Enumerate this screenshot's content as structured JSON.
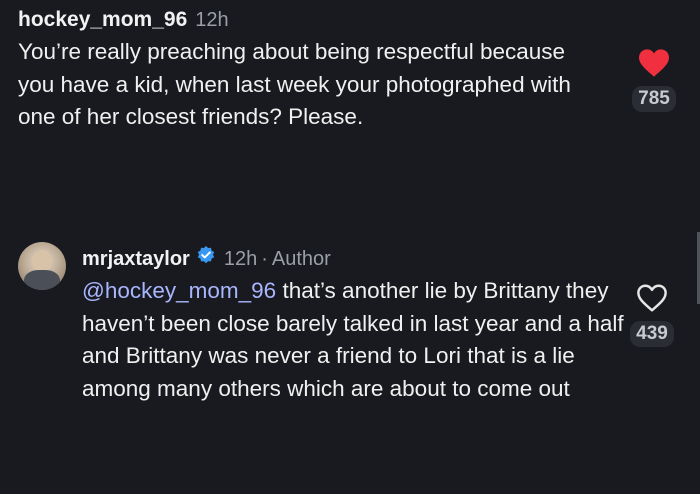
{
  "comments": [
    {
      "username": "hockey_mom_96",
      "time": "12h",
      "text": "You’re  really preaching about being respectful because you have a kid, when last week your photographed with one of her closest friends? Please.",
      "likes": "785",
      "liked": true
    },
    {
      "username": "mrjaxtaylor",
      "time": "12h",
      "separator": "·",
      "badge": "Author",
      "mention": "@hockey_mom_96",
      "text": " that’s another lie by Brittany they haven’t been close barely talked in last year and a half and Brittany was never a friend to Lori that is a lie among many others which are about to come out",
      "likes": "439",
      "liked": false,
      "verified": true
    }
  ],
  "colors": {
    "background": "#181a1f",
    "heart_filled": "#f0303f",
    "mention": "#a8b6ff",
    "verified_badge": "#3897f0"
  }
}
